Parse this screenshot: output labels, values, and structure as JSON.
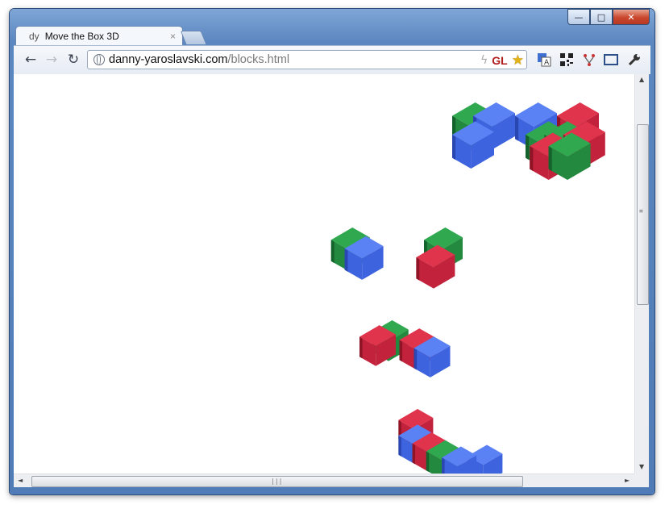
{
  "tab": {
    "favicon_text": "dy",
    "title": "Move the Box 3D",
    "close_glyph": "×"
  },
  "titlebar": {
    "minimize_glyph": "—",
    "maximize_glyph": "□",
    "close_glyph": "✕"
  },
  "toolbar": {
    "back_glyph": "←",
    "forward_glyph": "→",
    "reload_glyph": "↻"
  },
  "address_bar": {
    "host": "danny-yaroslavski.com",
    "path": "/blocks.html",
    "gl_badge": "GL"
  },
  "extensions": [
    "translate-icon",
    "qr-code-icon",
    "fork-icon",
    "fullscreen-icon",
    "wrench-icon"
  ],
  "scrollbars": {
    "up": "▲",
    "down": "▼",
    "left": "◄",
    "right": "►",
    "grip_v": "≡",
    "grip_h": "|||"
  },
  "colors": {
    "red": [
      "#e0334c",
      "#c2223b",
      "#8e1426"
    ],
    "green": [
      "#2fa84f",
      "#23893f",
      "#15632c"
    ],
    "blue": [
      "#5a82f5",
      "#3e63de",
      "#2a46b0"
    ]
  },
  "blocks": [
    {
      "gx": 4,
      "gy": 0,
      "z": 2,
      "c": "green"
    },
    {
      "gx": 5,
      "gy": 0,
      "z": 2,
      "c": "blue"
    },
    {
      "gx": 4,
      "gy": 1,
      "z": 2,
      "c": "blue"
    },
    {
      "gx": 7,
      "gy": 0,
      "z": 2,
      "c": "blue"
    },
    {
      "gx": 9,
      "gy": 0,
      "z": 2,
      "c": "red"
    },
    {
      "gx": 7.5,
      "gy": 1,
      "z": 2,
      "c": "green"
    },
    {
      "gx": 8.4,
      "gy": 1,
      "z": 2,
      "c": "green"
    },
    {
      "gx": 9.3,
      "gy": 1,
      "z": 2,
      "c": "red"
    },
    {
      "gx": 7.7,
      "gy": 1.6,
      "z": 2,
      "c": "red"
    },
    {
      "gx": 8.6,
      "gy": 1.6,
      "z": 2,
      "c": "green"
    },
    {
      "gx": 1.2,
      "gy": 0,
      "z": 1,
      "c": "green"
    },
    {
      "gx": 1.9,
      "gy": 0.5,
      "z": 1,
      "c": "blue"
    },
    {
      "gx": 6.0,
      "gy": 0,
      "z": 1,
      "c": "green"
    },
    {
      "gx": 5.6,
      "gy": 1,
      "z": 1,
      "c": "red"
    },
    {
      "gx": 2.4,
      "gy": 0.3,
      "z": 0.6,
      "c": "red"
    },
    {
      "gx": 3.1,
      "gy": 0,
      "z": 0.6,
      "c": "green"
    },
    {
      "gx": 4.6,
      "gy": 0.5,
      "z": 0.6,
      "c": "red"
    },
    {
      "gx": 5.4,
      "gy": 1,
      "z": 0.6,
      "c": "blue"
    },
    {
      "gx": 3.6,
      "gy": 0,
      "z": 0.2,
      "c": "red"
    },
    {
      "gx": 3.6,
      "gy": 1,
      "z": 0.2,
      "c": "blue"
    },
    {
      "gx": 4.4,
      "gy": 1.5,
      "z": 0.2,
      "c": "red"
    },
    {
      "gx": 5.2,
      "gy": 2.0,
      "z": 0.2,
      "c": "green"
    },
    {
      "gx": 6.1,
      "gy": 2.4,
      "z": 0.2,
      "c": "blue"
    },
    {
      "gx": 7.6,
      "gy": 2.3,
      "z": 0.2,
      "c": "blue"
    }
  ]
}
